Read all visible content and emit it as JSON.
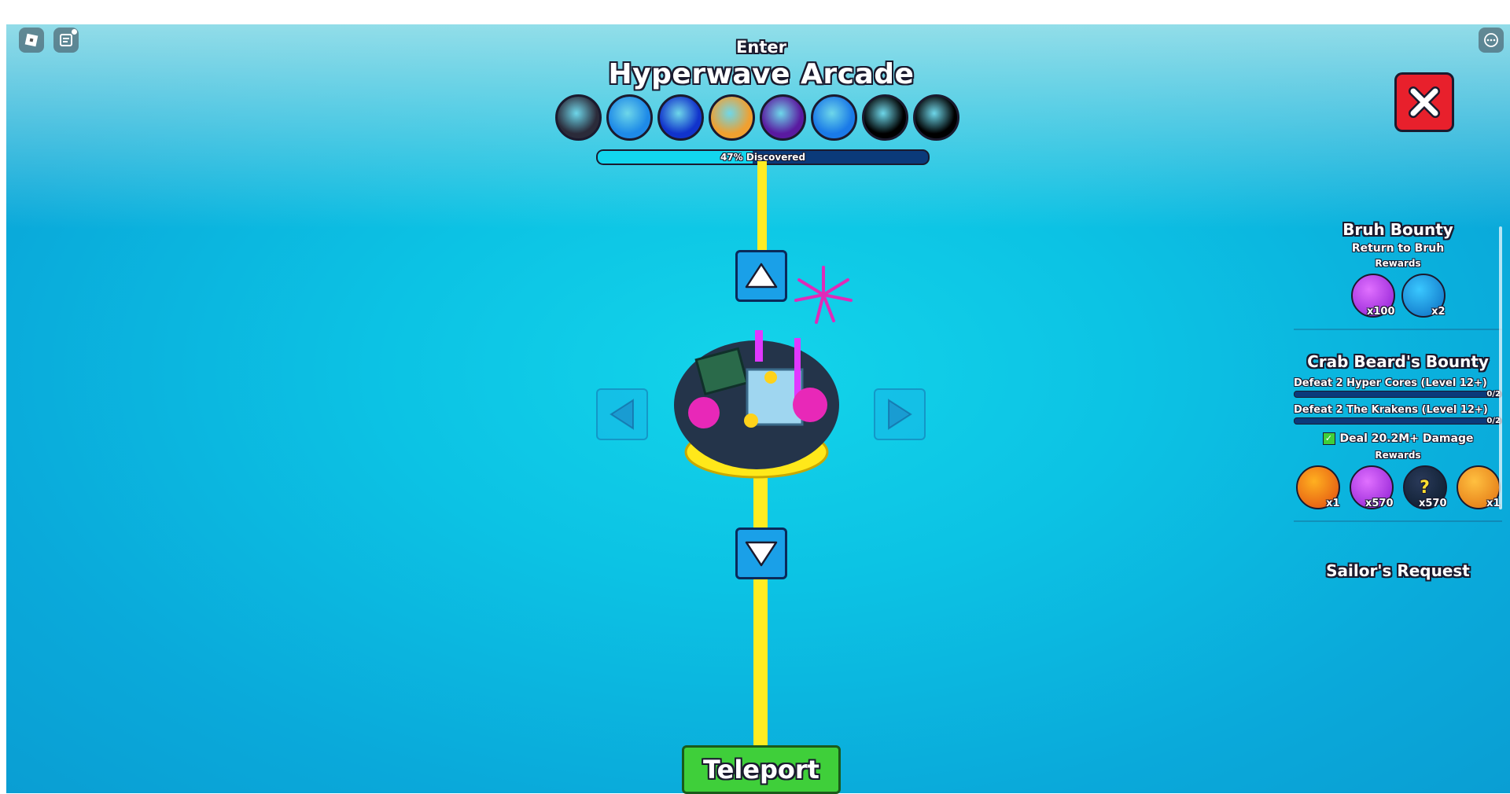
{
  "topbar": {
    "menu_icon": "roblox-logo-icon",
    "chat_icon": "chat-icon",
    "more_icon": "more-icon"
  },
  "hud": {
    "enter_label": "Enter",
    "area_title": "Hyperwave Arcade",
    "discover_text": "47% Discovered",
    "discover_fraction": 0.47,
    "pets": [
      {
        "name": "panda-pet-icon",
        "color": "#2b2b3a"
      },
      {
        "name": "blue-cat-pet-icon",
        "color": "#1e8ae8"
      },
      {
        "name": "glitch-pet-icon",
        "color": "#1133cc"
      },
      {
        "name": "orange-pet-icon",
        "color": "#f0a030"
      },
      {
        "name": "purple-pet-icon",
        "color": "#5a1aa0"
      },
      {
        "name": "rainbow-pet-icon",
        "color": "#1a7ae8"
      },
      {
        "name": "locked-pet-icon",
        "color": "#000000"
      },
      {
        "name": "locked-pet-icon",
        "color": "#000000"
      }
    ]
  },
  "teleport": {
    "label": "Teleport"
  },
  "close": {
    "icon": "close-icon"
  },
  "quests": {
    "q1": {
      "title": "Bruh Bounty",
      "subtitle": "Return to Bruh",
      "rewards_label": "Rewards",
      "rewards": [
        {
          "icon": "gem-icon",
          "count": "x100"
        },
        {
          "icon": "potion-icon",
          "count": "x2"
        }
      ]
    },
    "q2": {
      "title": "Crab Beard's Bounty",
      "tasks": [
        {
          "text": "Defeat 2 Hyper Cores (Level 12+)",
          "progress": "0/2"
        },
        {
          "text": "Defeat 2 The Krakens (Level 12+)",
          "progress": "0/2"
        }
      ],
      "done_task": "Deal 20.2M+ Damage",
      "rewards_label": "Rewards",
      "rewards": [
        {
          "icon": "flower-egg-icon",
          "count": "x1"
        },
        {
          "icon": "gem-icon",
          "count": "x570"
        },
        {
          "icon": "mystery-icon",
          "count": "x570"
        },
        {
          "icon": "orange-egg-icon",
          "count": "x1"
        }
      ]
    },
    "q3": {
      "title": "Sailor's Request"
    }
  }
}
